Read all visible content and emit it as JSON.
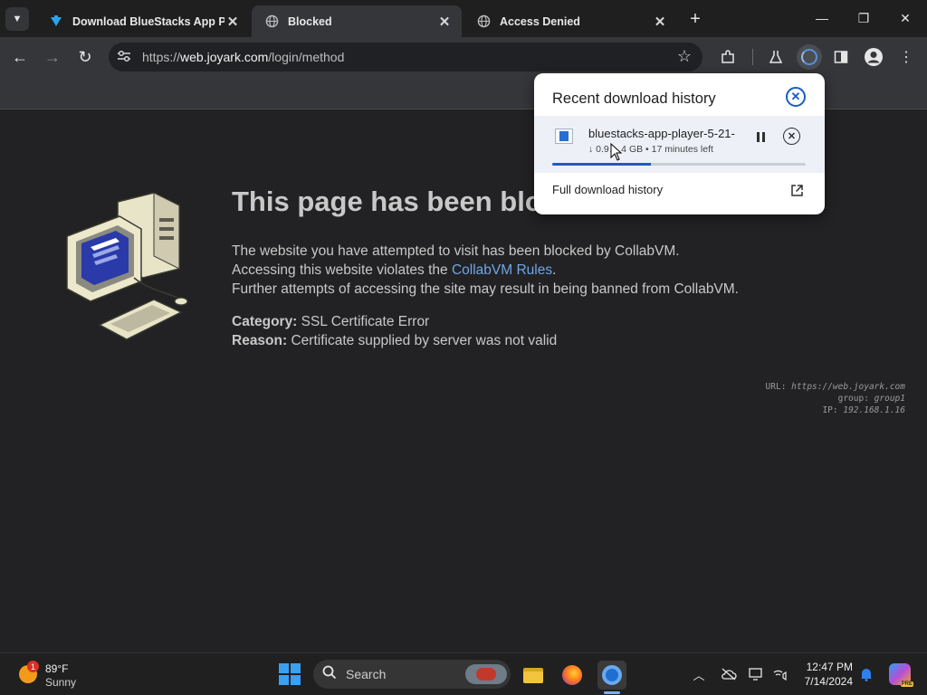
{
  "tabs": [
    {
      "title": "Download BlueStacks App Play",
      "favicon": "bluestacks-download-icon",
      "active": false
    },
    {
      "title": "Blocked",
      "favicon": "globe-icon",
      "active": true
    },
    {
      "title": "Access Denied",
      "favicon": "globe-icon",
      "active": false
    }
  ],
  "toolbar": {
    "url_scheme": "https://",
    "url_host": "web.joyark.com",
    "url_path": "/login/method"
  },
  "page": {
    "headline": "This page has been blo",
    "line1": "The website you have attempted to visit has been blocked by CollabVM.",
    "line2_prefix": "Accessing this website violates the ",
    "line2_link": "CollabVM Rules",
    "line2_suffix": ".",
    "line3": "Further attempts of accessing the site may result in being banned from CollabVM.",
    "category_label": "Category:",
    "category_value": "SSL Certificate Error",
    "reason_label": "Reason:",
    "reason_value": "Certificate supplied by server was not valid",
    "meta_url_label": "URL:",
    "meta_url_value": "https://web.joyark.com",
    "meta_group_label": "group:",
    "meta_group_value": "group1",
    "meta_ip_label": "IP:",
    "meta_ip_value": "192.168.1.16",
    "link_color": "#6fa6e6"
  },
  "downloads": {
    "title": "Recent download history",
    "item_name": "bluestacks-app-player-5-21-",
    "item_status": "↓ 0.9… 4 GB • 17 minutes left",
    "progress": 0.39,
    "full_history": "Full download history",
    "accent": "#1a5cc4"
  },
  "taskbar": {
    "weather_badge": "1",
    "weather_temp": "89°F",
    "weather_desc": "Sunny",
    "search_label": "Search",
    "time": "12:47 PM",
    "date": "7/14/2024",
    "copilot_badge": "PRE"
  }
}
